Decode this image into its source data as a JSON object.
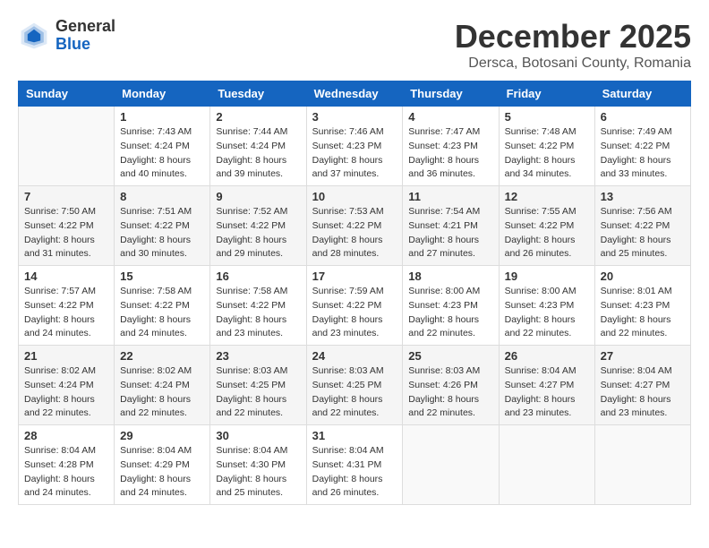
{
  "logo": {
    "general": "General",
    "blue": "Blue"
  },
  "header": {
    "month": "December 2025",
    "location": "Dersca, Botosani County, Romania"
  },
  "weekdays": [
    "Sunday",
    "Monday",
    "Tuesday",
    "Wednesday",
    "Thursday",
    "Friday",
    "Saturday"
  ],
  "weeks": [
    [
      {
        "day": "",
        "sunrise": "",
        "sunset": "",
        "daylight": ""
      },
      {
        "day": "1",
        "sunrise": "Sunrise: 7:43 AM",
        "sunset": "Sunset: 4:24 PM",
        "daylight": "Daylight: 8 hours and 40 minutes."
      },
      {
        "day": "2",
        "sunrise": "Sunrise: 7:44 AM",
        "sunset": "Sunset: 4:24 PM",
        "daylight": "Daylight: 8 hours and 39 minutes."
      },
      {
        "day": "3",
        "sunrise": "Sunrise: 7:46 AM",
        "sunset": "Sunset: 4:23 PM",
        "daylight": "Daylight: 8 hours and 37 minutes."
      },
      {
        "day": "4",
        "sunrise": "Sunrise: 7:47 AM",
        "sunset": "Sunset: 4:23 PM",
        "daylight": "Daylight: 8 hours and 36 minutes."
      },
      {
        "day": "5",
        "sunrise": "Sunrise: 7:48 AM",
        "sunset": "Sunset: 4:22 PM",
        "daylight": "Daylight: 8 hours and 34 minutes."
      },
      {
        "day": "6",
        "sunrise": "Sunrise: 7:49 AM",
        "sunset": "Sunset: 4:22 PM",
        "daylight": "Daylight: 8 hours and 33 minutes."
      }
    ],
    [
      {
        "day": "7",
        "sunrise": "Sunrise: 7:50 AM",
        "sunset": "Sunset: 4:22 PM",
        "daylight": "Daylight: 8 hours and 31 minutes."
      },
      {
        "day": "8",
        "sunrise": "Sunrise: 7:51 AM",
        "sunset": "Sunset: 4:22 PM",
        "daylight": "Daylight: 8 hours and 30 minutes."
      },
      {
        "day": "9",
        "sunrise": "Sunrise: 7:52 AM",
        "sunset": "Sunset: 4:22 PM",
        "daylight": "Daylight: 8 hours and 29 minutes."
      },
      {
        "day": "10",
        "sunrise": "Sunrise: 7:53 AM",
        "sunset": "Sunset: 4:22 PM",
        "daylight": "Daylight: 8 hours and 28 minutes."
      },
      {
        "day": "11",
        "sunrise": "Sunrise: 7:54 AM",
        "sunset": "Sunset: 4:21 PM",
        "daylight": "Daylight: 8 hours and 27 minutes."
      },
      {
        "day": "12",
        "sunrise": "Sunrise: 7:55 AM",
        "sunset": "Sunset: 4:22 PM",
        "daylight": "Daylight: 8 hours and 26 minutes."
      },
      {
        "day": "13",
        "sunrise": "Sunrise: 7:56 AM",
        "sunset": "Sunset: 4:22 PM",
        "daylight": "Daylight: 8 hours and 25 minutes."
      }
    ],
    [
      {
        "day": "14",
        "sunrise": "Sunrise: 7:57 AM",
        "sunset": "Sunset: 4:22 PM",
        "daylight": "Daylight: 8 hours and 24 minutes."
      },
      {
        "day": "15",
        "sunrise": "Sunrise: 7:58 AM",
        "sunset": "Sunset: 4:22 PM",
        "daylight": "Daylight: 8 hours and 24 minutes."
      },
      {
        "day": "16",
        "sunrise": "Sunrise: 7:58 AM",
        "sunset": "Sunset: 4:22 PM",
        "daylight": "Daylight: 8 hours and 23 minutes."
      },
      {
        "day": "17",
        "sunrise": "Sunrise: 7:59 AM",
        "sunset": "Sunset: 4:22 PM",
        "daylight": "Daylight: 8 hours and 23 minutes."
      },
      {
        "day": "18",
        "sunrise": "Sunrise: 8:00 AM",
        "sunset": "Sunset: 4:23 PM",
        "daylight": "Daylight: 8 hours and 22 minutes."
      },
      {
        "day": "19",
        "sunrise": "Sunrise: 8:00 AM",
        "sunset": "Sunset: 4:23 PM",
        "daylight": "Daylight: 8 hours and 22 minutes."
      },
      {
        "day": "20",
        "sunrise": "Sunrise: 8:01 AM",
        "sunset": "Sunset: 4:23 PM",
        "daylight": "Daylight: 8 hours and 22 minutes."
      }
    ],
    [
      {
        "day": "21",
        "sunrise": "Sunrise: 8:02 AM",
        "sunset": "Sunset: 4:24 PM",
        "daylight": "Daylight: 8 hours and 22 minutes."
      },
      {
        "day": "22",
        "sunrise": "Sunrise: 8:02 AM",
        "sunset": "Sunset: 4:24 PM",
        "daylight": "Daylight: 8 hours and 22 minutes."
      },
      {
        "day": "23",
        "sunrise": "Sunrise: 8:03 AM",
        "sunset": "Sunset: 4:25 PM",
        "daylight": "Daylight: 8 hours and 22 minutes."
      },
      {
        "day": "24",
        "sunrise": "Sunrise: 8:03 AM",
        "sunset": "Sunset: 4:25 PM",
        "daylight": "Daylight: 8 hours and 22 minutes."
      },
      {
        "day": "25",
        "sunrise": "Sunrise: 8:03 AM",
        "sunset": "Sunset: 4:26 PM",
        "daylight": "Daylight: 8 hours and 22 minutes."
      },
      {
        "day": "26",
        "sunrise": "Sunrise: 8:04 AM",
        "sunset": "Sunset: 4:27 PM",
        "daylight": "Daylight: 8 hours and 23 minutes."
      },
      {
        "day": "27",
        "sunrise": "Sunrise: 8:04 AM",
        "sunset": "Sunset: 4:27 PM",
        "daylight": "Daylight: 8 hours and 23 minutes."
      }
    ],
    [
      {
        "day": "28",
        "sunrise": "Sunrise: 8:04 AM",
        "sunset": "Sunset: 4:28 PM",
        "daylight": "Daylight: 8 hours and 24 minutes."
      },
      {
        "day": "29",
        "sunrise": "Sunrise: 8:04 AM",
        "sunset": "Sunset: 4:29 PM",
        "daylight": "Daylight: 8 hours and 24 minutes."
      },
      {
        "day": "30",
        "sunrise": "Sunrise: 8:04 AM",
        "sunset": "Sunset: 4:30 PM",
        "daylight": "Daylight: 8 hours and 25 minutes."
      },
      {
        "day": "31",
        "sunrise": "Sunrise: 8:04 AM",
        "sunset": "Sunset: 4:31 PM",
        "daylight": "Daylight: 8 hours and 26 minutes."
      },
      {
        "day": "",
        "sunrise": "",
        "sunset": "",
        "daylight": ""
      },
      {
        "day": "",
        "sunrise": "",
        "sunset": "",
        "daylight": ""
      },
      {
        "day": "",
        "sunrise": "",
        "sunset": "",
        "daylight": ""
      }
    ]
  ]
}
